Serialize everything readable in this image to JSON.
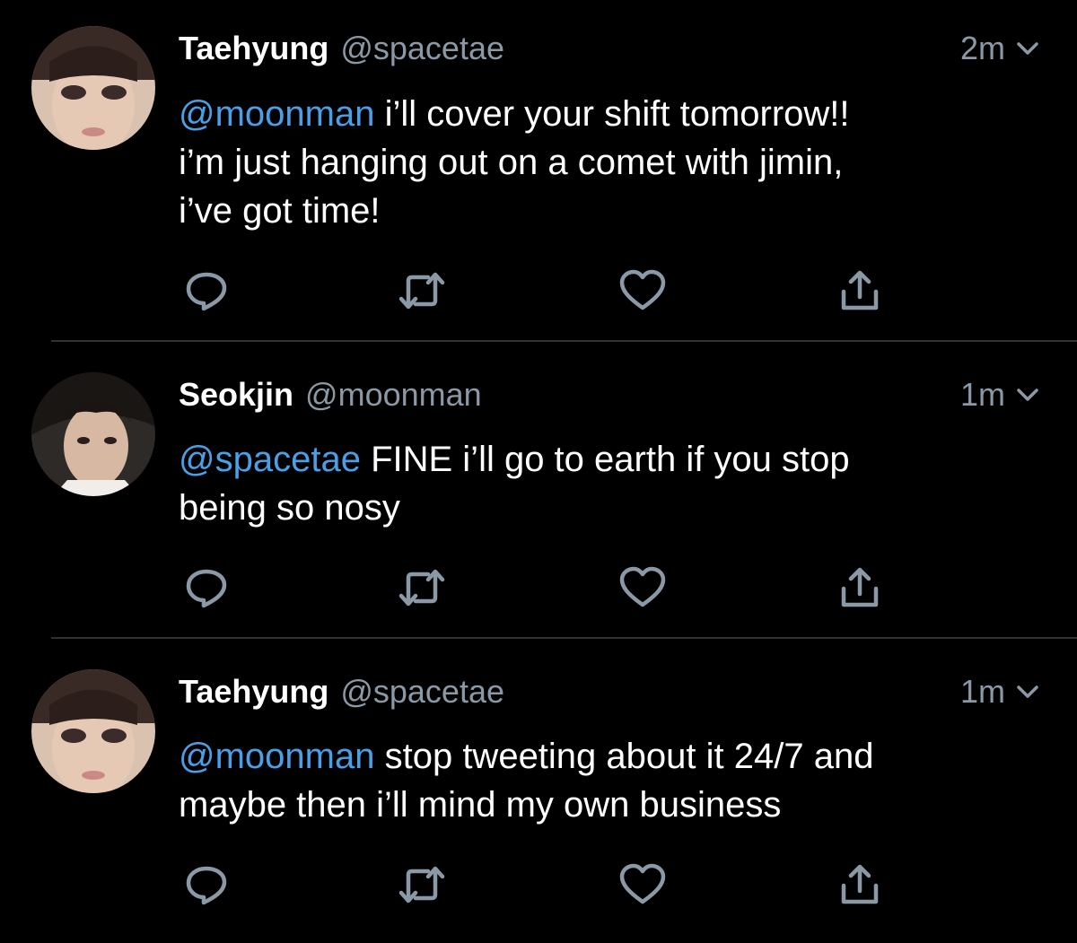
{
  "colors": {
    "background": "#000000",
    "text": "#ffffff",
    "secondary": "#8b98a5",
    "mention": "#4a9fe6",
    "divider": "#2f3336",
    "icon": "#8b98a5"
  },
  "tweets": [
    {
      "name": "Taehyung",
      "handle": "@spacetae",
      "time": "2m",
      "mention": "@moonman",
      "text": " i’ll cover your shift tomorrow!!\ni’m just hanging out on a comet with jimin,\ni’ve got time!",
      "icons": [
        "reply-icon",
        "retweet-icon",
        "like-icon",
        "share-icon"
      ]
    },
    {
      "name": "Seokjin",
      "handle": "@moonman",
      "time": "1m",
      "mention": "@spacetae",
      "text": " FINE i’ll go to earth if you stop\nbeing so nosy",
      "icons": [
        "reply-icon",
        "retweet-icon",
        "like-icon",
        "share-icon"
      ]
    },
    {
      "name": "Taehyung",
      "handle": "@spacetae",
      "time": "1m",
      "mention": "@moonman",
      "text": " stop tweeting about it 24/7 and\nmaybe then i’ll mind my own business",
      "icons": [
        "reply-icon",
        "retweet-icon",
        "like-icon",
        "share-icon"
      ]
    }
  ]
}
